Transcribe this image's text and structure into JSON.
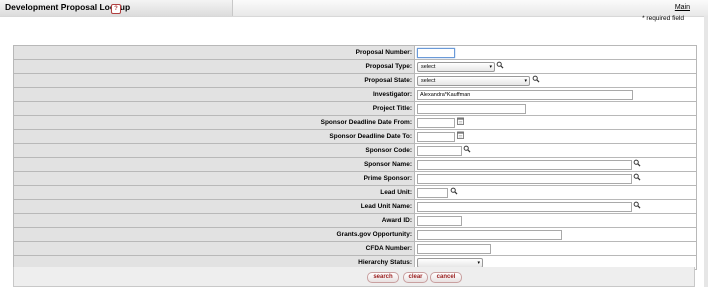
{
  "header": {
    "title": "Development Proposal Lookup",
    "help_glyph": "?",
    "main_link": "Main",
    "required_note": "* required field"
  },
  "form": {
    "rows": [
      {
        "label": "Proposal Number:",
        "value": ""
      },
      {
        "label": "Proposal Type:",
        "value": "select"
      },
      {
        "label": "Proposal State:",
        "value": "select"
      },
      {
        "label": "Investigator:",
        "value": "Alexandra*Kauffman"
      },
      {
        "label": "Project Title:",
        "value": ""
      },
      {
        "label": "Sponsor Deadline Date From:",
        "value": ""
      },
      {
        "label": "Sponsor Deadline Date To:",
        "value": ""
      },
      {
        "label": "Sponsor Code:",
        "value": ""
      },
      {
        "label": "Sponsor Name:",
        "value": ""
      },
      {
        "label": "Prime Sponsor:",
        "value": ""
      },
      {
        "label": "Lead Unit:",
        "value": ""
      },
      {
        "label": "Lead Unit Name:",
        "value": ""
      },
      {
        "label": "Award ID:",
        "value": ""
      },
      {
        "label": "Grants.gov Opportunity:",
        "value": ""
      },
      {
        "label": "CFDA Number:",
        "value": ""
      },
      {
        "label": "Hierarchy Status:",
        "value": ""
      }
    ]
  },
  "buttons": {
    "search": "search",
    "clear": "clear",
    "cancel": "cancel"
  },
  "icons": {
    "lookup": "magnifier-lookup-icon",
    "calendar": "calendar-icon",
    "dropdown": "chevron-down-icon"
  }
}
